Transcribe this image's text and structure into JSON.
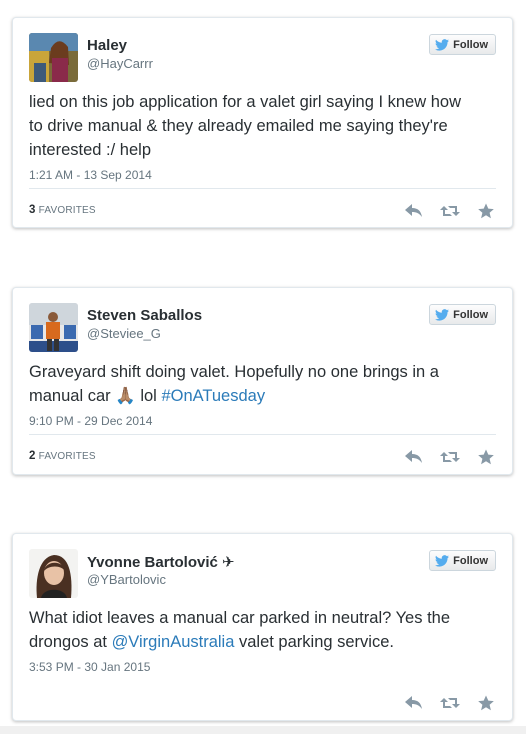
{
  "follow_label": "Follow",
  "colors": {
    "link": "#2b7bb9",
    "twitter_blue": "#55acee",
    "muted": "#66757f"
  },
  "tweets": [
    {
      "name": "Haley",
      "handle": "@HayCarrr",
      "text_parts": [
        "lied on this job application for a valet girl saying I knew how to drive manual & they already emailed me saying they're interested :/ help"
      ],
      "timestamp": "1:21 AM - 13 Sep 2014",
      "favorites_count": "3",
      "favorites_label": "FAVORITES",
      "avatar_icon": "user-avatar-photo"
    },
    {
      "name": "Steven Saballos",
      "handle": "@Steviee_G",
      "text_before": "Graveyard shift doing valet. Hopefully no one brings in a manual car 🙏🏽 lol ",
      "hashtag": "#OnATuesday",
      "timestamp": "9:10 PM - 29 Dec 2014",
      "favorites_count": "2",
      "favorites_label": "FAVORITES",
      "avatar_icon": "user-avatar-photo"
    },
    {
      "name": "Yvonne Bartolović ✈",
      "handle": "@YBartolovic",
      "text_before": "What idiot leaves a manual car parked in neutral? Yes the drongos at ",
      "mention": "@VirginAustralia",
      "text_after": " valet parking service.",
      "timestamp": "3:53 PM - 30 Jan 2015",
      "avatar_icon": "user-avatar-photo"
    }
  ]
}
